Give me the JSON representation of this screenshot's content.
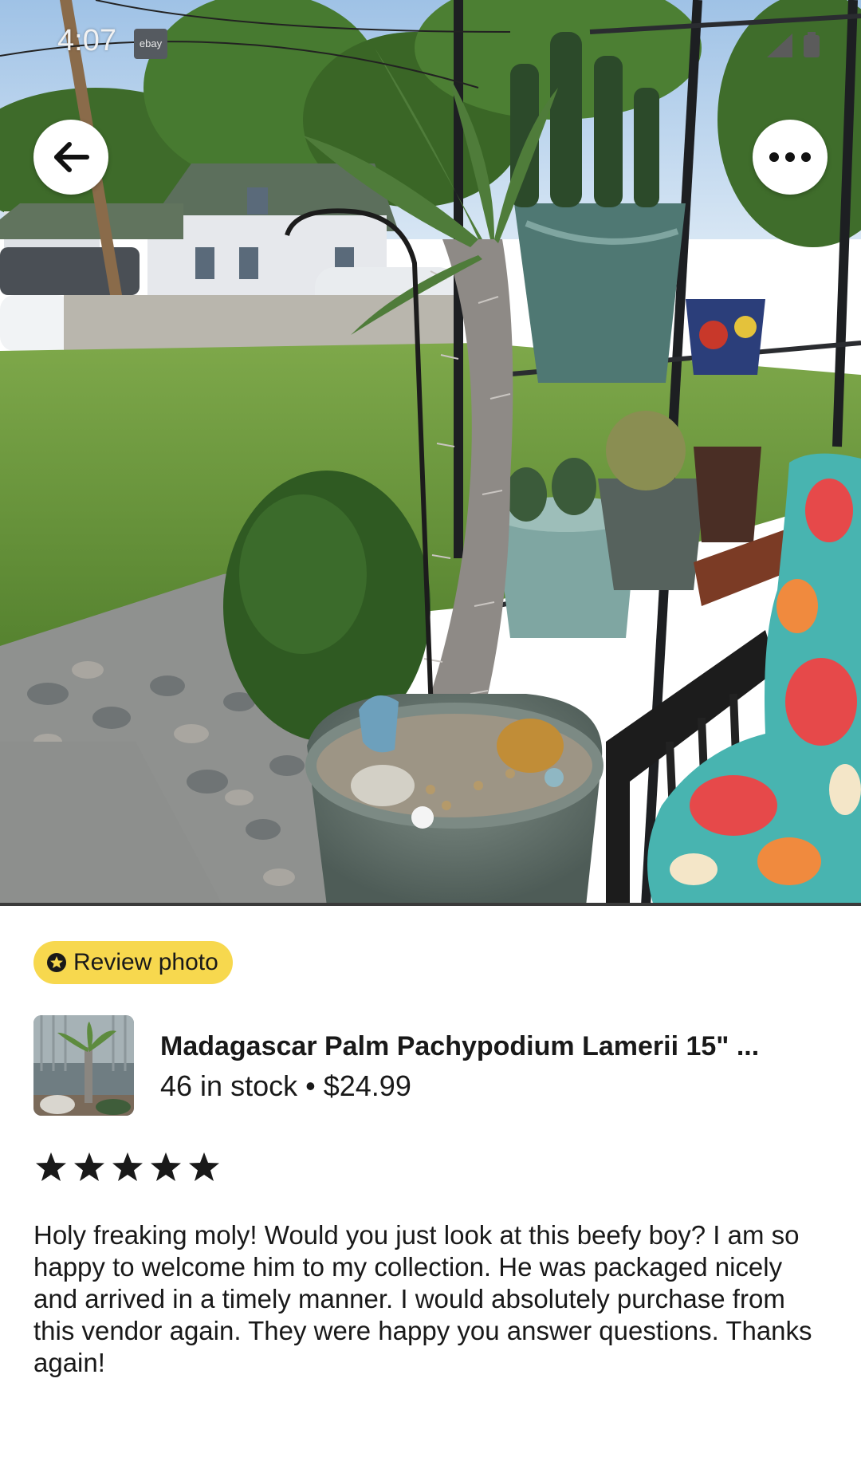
{
  "status_bar": {
    "time": "4:07",
    "app_badge": "ebay"
  },
  "nav": {
    "back_icon": "arrow-left-icon",
    "more_icon": "more-horizontal-icon"
  },
  "review_badge": {
    "icon": "star-badge-icon",
    "label": "Review photo",
    "color": "#f7d84e"
  },
  "product": {
    "title": "Madagascar Palm Pachypodium Lamerii 15\" ...",
    "stock": "46 in stock",
    "separator": "•",
    "price": "$24.99"
  },
  "rating": {
    "stars": 5,
    "max": 5
  },
  "review": {
    "text": "Holy freaking moly! Would you just look at this beefy boy? I am so happy to welcome him to my collection. He was packaged nicely and arrived in a timely manner. I would absolutely purchase from this vendor again. They were happy you answer questions. Thanks again!"
  }
}
